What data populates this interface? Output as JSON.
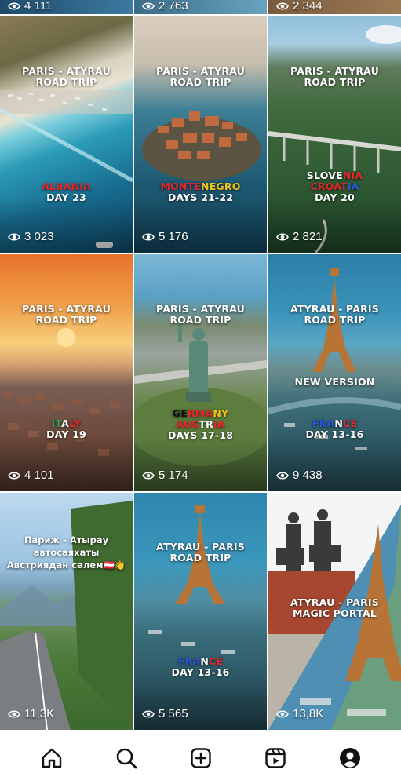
{
  "top_row_counts": [
    "4 111",
    "2 763",
    "2 344"
  ],
  "tiles": [
    {
      "lines": [
        [
          "PARIS - ATYRAU"
        ],
        [
          "ROAD TRIP"
        ]
      ],
      "country": [
        [
          [
            "ALBANIA",
            "c-red"
          ]
        ],
        [
          [
            "DAY 23",
            "c-white"
          ]
        ]
      ],
      "views": "3 023"
    },
    {
      "lines": [
        [
          "PARIS - ATYRAU"
        ],
        [
          "ROAD TRIP"
        ]
      ],
      "country": [
        [
          [
            "MONTE",
            "c-red"
          ],
          [
            "NEGRO",
            "c-gold"
          ]
        ],
        [
          [
            "DAYS 21-22",
            "c-white"
          ]
        ]
      ],
      "views": "5 176"
    },
    {
      "lines": [
        [
          "PARIS - ATYRAU"
        ],
        [
          "ROAD TRIP"
        ]
      ],
      "country": [
        [
          [
            "SLOVE",
            "c-white"
          ],
          [
            "NIA",
            "c-red"
          ]
        ],
        [
          [
            "CROAT",
            "c-red"
          ],
          [
            "IA",
            "c-blue"
          ]
        ],
        [
          [
            "DAY 20",
            "c-white"
          ]
        ]
      ],
      "views": "2 821"
    },
    {
      "lines": [
        [
          "PARIS - ATYRAU"
        ],
        [
          "ROAD TRIP"
        ]
      ],
      "country": [
        [
          [
            "IT",
            "c-green"
          ],
          [
            "A",
            "c-white"
          ],
          [
            "LY",
            "c-red"
          ]
        ],
        [
          [
            "DAY 19",
            "c-white"
          ]
        ]
      ],
      "views": "4 101"
    },
    {
      "lines": [
        [
          "PARIS - ATYRAU"
        ],
        [
          "ROAD TRIP"
        ]
      ],
      "country": [
        [
          [
            "GE",
            "c-black"
          ],
          [
            "RMA",
            "c-red"
          ],
          [
            "NY",
            "c-gold"
          ]
        ],
        [
          [
            "AUS",
            "c-red"
          ],
          [
            "TR",
            "c-white"
          ],
          [
            "IA",
            "c-red"
          ]
        ],
        [
          [
            "DAYS 17-18",
            "c-white"
          ]
        ]
      ],
      "views": "5 174"
    },
    {
      "lines": [
        [
          "ATYRAU - PARIS"
        ],
        [
          "ROAD TRIP"
        ]
      ],
      "extra": "NEW VERSION",
      "country": [
        [
          [
            "FRA",
            "c-blue"
          ],
          [
            "N",
            "c-white"
          ],
          [
            "CE",
            "c-red"
          ]
        ],
        [
          [
            "DAY 13-16",
            "c-white"
          ]
        ]
      ],
      "views": "9 438"
    },
    {
      "caption": [
        "Париж - Атырау",
        "автосаяхаты",
        "Австриядан сәлем🇦🇹👋"
      ],
      "views": "11,3K"
    },
    {
      "lines": [
        [
          "ATYRAU - PARIS"
        ],
        [
          "ROAD TRIP"
        ]
      ],
      "country": [
        [
          [
            "FRA",
            "c-blue"
          ],
          [
            "N",
            "c-white"
          ],
          [
            "CE",
            "c-red"
          ]
        ],
        [
          [
            "DAY 13-16",
            "c-white"
          ]
        ]
      ],
      "views": "5 565"
    },
    {
      "lines": [
        [
          "ATYRAU - PARIS"
        ],
        [
          "MAGIC PORTAL"
        ]
      ],
      "views": "13,8K"
    }
  ],
  "nav": [
    "home-icon",
    "search-icon",
    "create-icon",
    "reels-icon",
    "profile-icon"
  ],
  "colors": {
    "red": "#e3262b",
    "blue": "#2a54d6",
    "gold": "#f2c318",
    "green": "#2ea44f"
  }
}
